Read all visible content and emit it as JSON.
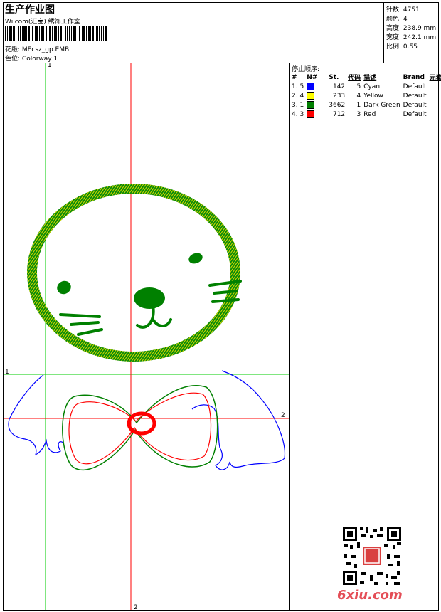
{
  "header": {
    "title": "生产作业图",
    "company": "Wilcom(汇宝) 绣饰工作室",
    "pattern_label": "花版:",
    "pattern_value": "MEcsz_gp.EMB",
    "colorway_label": "色位:",
    "colorway_value": "Colorway 1"
  },
  "stats": {
    "stitches_label": "针数:",
    "stitches_value": "4751",
    "colors_label": "颜色:",
    "colors_value": "4",
    "height_label": "高度:",
    "height_value": "238.9 mm",
    "width_label": "宽度:",
    "width_value": "242.1 mm",
    "scale_label": "比例:",
    "scale_value": "0.55"
  },
  "stop_sequence": {
    "title": "停止顺序:",
    "columns": [
      "#",
      "N#",
      "St.",
      "代码",
      "描述",
      "Brand",
      "元素"
    ],
    "rows": [
      {
        "order": "1. 5",
        "color": "#0000ff",
        "stitches": "142",
        "code": "5",
        "description": "Cyan",
        "brand": "Default"
      },
      {
        "order": "2. 4",
        "color": "#ffff00",
        "stitches": "233",
        "code": "4",
        "description": "Yellow",
        "brand": "Default"
      },
      {
        "order": "3. 1",
        "color": "#008000",
        "stitches": "3662",
        "code": "1",
        "description": "Dark Green",
        "brand": "Default"
      },
      {
        "order": "4. 3",
        "color": "#ff0000",
        "stitches": "712",
        "code": "3",
        "description": "Red",
        "brand": "Default"
      }
    ]
  },
  "axis_labels": {
    "green_v": "1",
    "green_h": "1",
    "red_h": "2",
    "red_v": "2"
  },
  "colors": {
    "green_line": "#00cc00",
    "red_line": "#ff0000",
    "thread_green": "#008000",
    "thread_yellow": "#e6e600",
    "thread_blue": "#0000ff",
    "thread_red": "#ff0000"
  },
  "brand": "6xiu.com"
}
